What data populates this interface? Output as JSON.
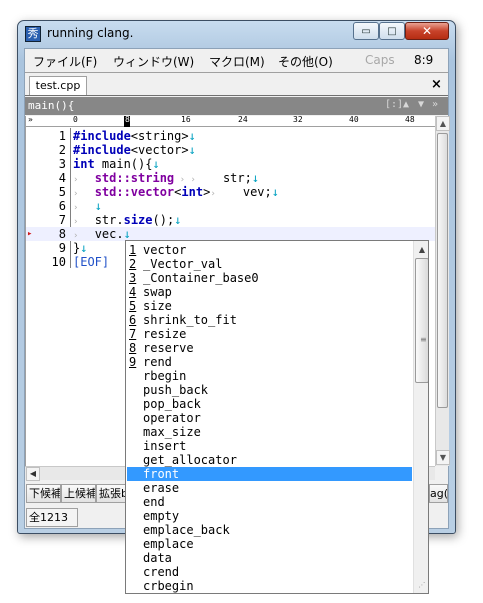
{
  "window": {
    "title": "running clang.",
    "app_icon_glyph": "秀",
    "min_glyph": "▭",
    "max_glyph": "□",
    "close_glyph": "✕"
  },
  "menu": {
    "file": "ファイル(F)",
    "window": "ウィンドウ(W)",
    "macro": "マクロ(M)",
    "other": "その他(O)",
    "caps": "Caps",
    "position": "8:9"
  },
  "tab": {
    "label": "test.cpp",
    "close": "×"
  },
  "function_bar": {
    "label": "main(){",
    "controls": [
      "[:]",
      "▲",
      "▼",
      "»"
    ]
  },
  "ruler": {
    "corner": "»",
    "marks": [
      "0",
      "8",
      "16",
      "24",
      "32",
      "40",
      "48"
    ]
  },
  "code": [
    {
      "n": "1",
      "parts": [
        [
          "kw",
          "#include"
        ],
        [
          "tx",
          "<string>"
        ],
        [
          "ar",
          "↓"
        ]
      ]
    },
    {
      "n": "2",
      "parts": [
        [
          "kw",
          "#include"
        ],
        [
          "tx",
          "<vector>"
        ],
        [
          "ar",
          "↓"
        ]
      ]
    },
    {
      "n": "3",
      "parts": [
        [
          "kw",
          "int"
        ],
        [
          "tx",
          " main(){"
        ],
        [
          "ar",
          "↓"
        ]
      ]
    },
    {
      "n": "4",
      "parts": [
        [
          "tb",
          "›   "
        ],
        [
          "type",
          "std::string"
        ],
        [
          "tb",
          " › › "
        ],
        [
          "tx",
          "   str;"
        ],
        [
          "ar",
          "↓"
        ]
      ]
    },
    {
      "n": "5",
      "parts": [
        [
          "tb",
          "›   "
        ],
        [
          "type",
          "std::vector"
        ],
        [
          "tx",
          "<"
        ],
        [
          "kw",
          "int"
        ],
        [
          "tx",
          ">"
        ],
        [
          "tb",
          "› "
        ],
        [
          "tx",
          "   vev;"
        ],
        [
          "ar",
          "↓"
        ]
      ]
    },
    {
      "n": "6",
      "parts": [
        [
          "tb",
          "›   "
        ],
        [
          "ar",
          "↓"
        ]
      ]
    },
    {
      "n": "7",
      "parts": [
        [
          "tb",
          "›   "
        ],
        [
          "tx",
          "str."
        ],
        [
          "kw",
          "size"
        ],
        [
          "tx",
          "();"
        ],
        [
          "ar",
          "↓"
        ]
      ]
    },
    {
      "n": "8",
      "parts": [
        [
          "tb",
          "›   "
        ],
        [
          "tx",
          "vec."
        ],
        [
          "ar",
          "↓"
        ]
      ]
    },
    {
      "n": "9",
      "parts": [
        [
          "tx",
          "}"
        ],
        [
          "ar",
          "↓"
        ]
      ]
    },
    {
      "n": "10",
      "parts": [
        [
          "eof",
          "[EOF]"
        ]
      ]
    }
  ],
  "current_line": "8",
  "fkeys": [
    "下候補",
    "上候補",
    "拡張b"
  ],
  "fkey_right": "ag(",
  "status": {
    "text": "全1213"
  },
  "completion": {
    "selected": "front",
    "items": [
      {
        "num": "1",
        "name": "vector"
      },
      {
        "num": "2",
        "name": "_Vector_val"
      },
      {
        "num": "3",
        "name": "_Container_base0"
      },
      {
        "num": "4",
        "name": "swap"
      },
      {
        "num": "5",
        "name": "size"
      },
      {
        "num": "6",
        "name": "shrink_to_fit"
      },
      {
        "num": "7",
        "name": "resize"
      },
      {
        "num": "8",
        "name": "reserve"
      },
      {
        "num": "9",
        "name": "rend"
      },
      {
        "num": "",
        "name": "rbegin"
      },
      {
        "num": "",
        "name": "push_back"
      },
      {
        "num": "",
        "name": "pop_back"
      },
      {
        "num": "",
        "name": "operator"
      },
      {
        "num": "",
        "name": "max_size"
      },
      {
        "num": "",
        "name": "insert"
      },
      {
        "num": "",
        "name": "get_allocator"
      },
      {
        "num": "",
        "name": "front"
      },
      {
        "num": "",
        "name": "erase"
      },
      {
        "num": "",
        "name": "end"
      },
      {
        "num": "",
        "name": "empty"
      },
      {
        "num": "",
        "name": "emplace_back"
      },
      {
        "num": "",
        "name": "emplace"
      },
      {
        "num": "",
        "name": "data"
      },
      {
        "num": "",
        "name": "crend"
      },
      {
        "num": "",
        "name": "crbegin"
      }
    ]
  },
  "colors": {
    "keyword": "#0000b8",
    "type": "#8000a0",
    "newline_arrow": "#00a0c0",
    "selection": "#3399ff",
    "function_bar": "#878787"
  }
}
